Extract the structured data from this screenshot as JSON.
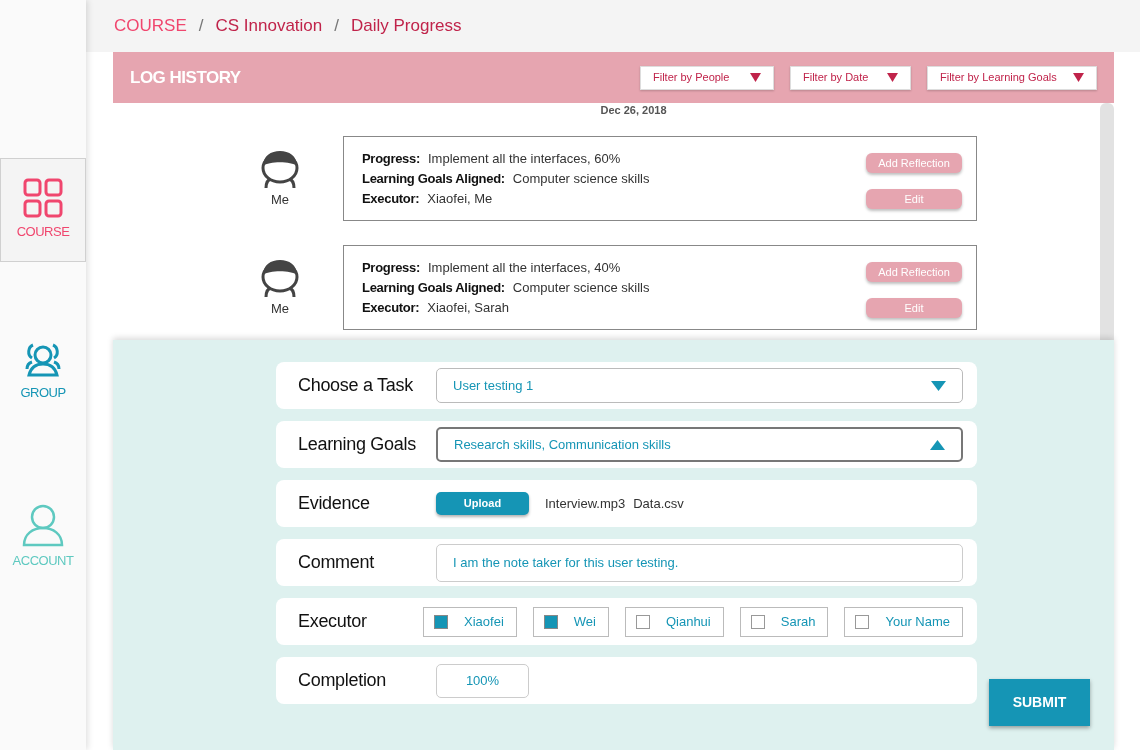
{
  "sidebar": {
    "items": [
      {
        "label": "COURSE",
        "kind": "grid",
        "selected": true,
        "color": "#f0466e"
      },
      {
        "label": "GROUP",
        "kind": "group",
        "selected": false,
        "color": "#1595b5"
      },
      {
        "label": "ACCOUNT",
        "kind": "person",
        "selected": false,
        "color": "#5ec9c0"
      }
    ]
  },
  "breadcrumb": [
    {
      "label": "COURSE"
    },
    {
      "label": "CS Innovation"
    },
    {
      "label": "Daily Progress"
    }
  ],
  "breadcrumb_separator": "/",
  "log_history": {
    "title": "LOG HISTORY",
    "filters": [
      {
        "label": "Filter by People"
      },
      {
        "label": "Filter by Date"
      },
      {
        "label": "Filter by Learning Goals"
      }
    ],
    "date": "Dec 26, 2018",
    "entries": [
      {
        "author": "Me",
        "fields": [
          {
            "label": "Progress:",
            "value": "Implement all the interfaces, 60%"
          },
          {
            "label": "Learning Goals Aligned:",
            "value": "Computer science skills"
          },
          {
            "label": "Executor:",
            "value": "Xiaofei, Me"
          }
        ],
        "buttons": [
          "Add Reflection",
          "Edit"
        ]
      },
      {
        "author": "Me",
        "fields": [
          {
            "label": "Progress:",
            "value": "Implement all the interfaces, 40%"
          },
          {
            "label": "Learning Goals Aligned:",
            "value": "Computer science skills"
          },
          {
            "label": "Executor:",
            "value": "Xiaofei, Sarah"
          }
        ],
        "buttons": [
          "Add Reflection",
          "Edit"
        ]
      }
    ]
  },
  "form": {
    "rows": [
      {
        "kind": "dropdown",
        "label": "Choose a Task",
        "value": "User testing 1",
        "expanded": false
      },
      {
        "kind": "dropdown",
        "label": "Learning Goals",
        "value": "Research skills, Communication skills",
        "expanded": true
      },
      {
        "kind": "upload",
        "label": "Evidence",
        "button": "Upload",
        "files": [
          "Interview.mp3",
          "Data.csv"
        ]
      },
      {
        "kind": "text",
        "label": "Comment",
        "value": "I am the note taker for this user testing."
      },
      {
        "kind": "checkboxes",
        "label": "Executor",
        "options": [
          {
            "label": "Xiaofei",
            "checked": true
          },
          {
            "label": "Wei",
            "checked": true
          },
          {
            "label": "Qianhui",
            "checked": false
          },
          {
            "label": "Sarah",
            "checked": false
          },
          {
            "label": "Your Name",
            "checked": false
          }
        ]
      },
      {
        "kind": "short",
        "label": "Completion",
        "value": "100%"
      }
    ],
    "submit": "SUBMIT"
  }
}
